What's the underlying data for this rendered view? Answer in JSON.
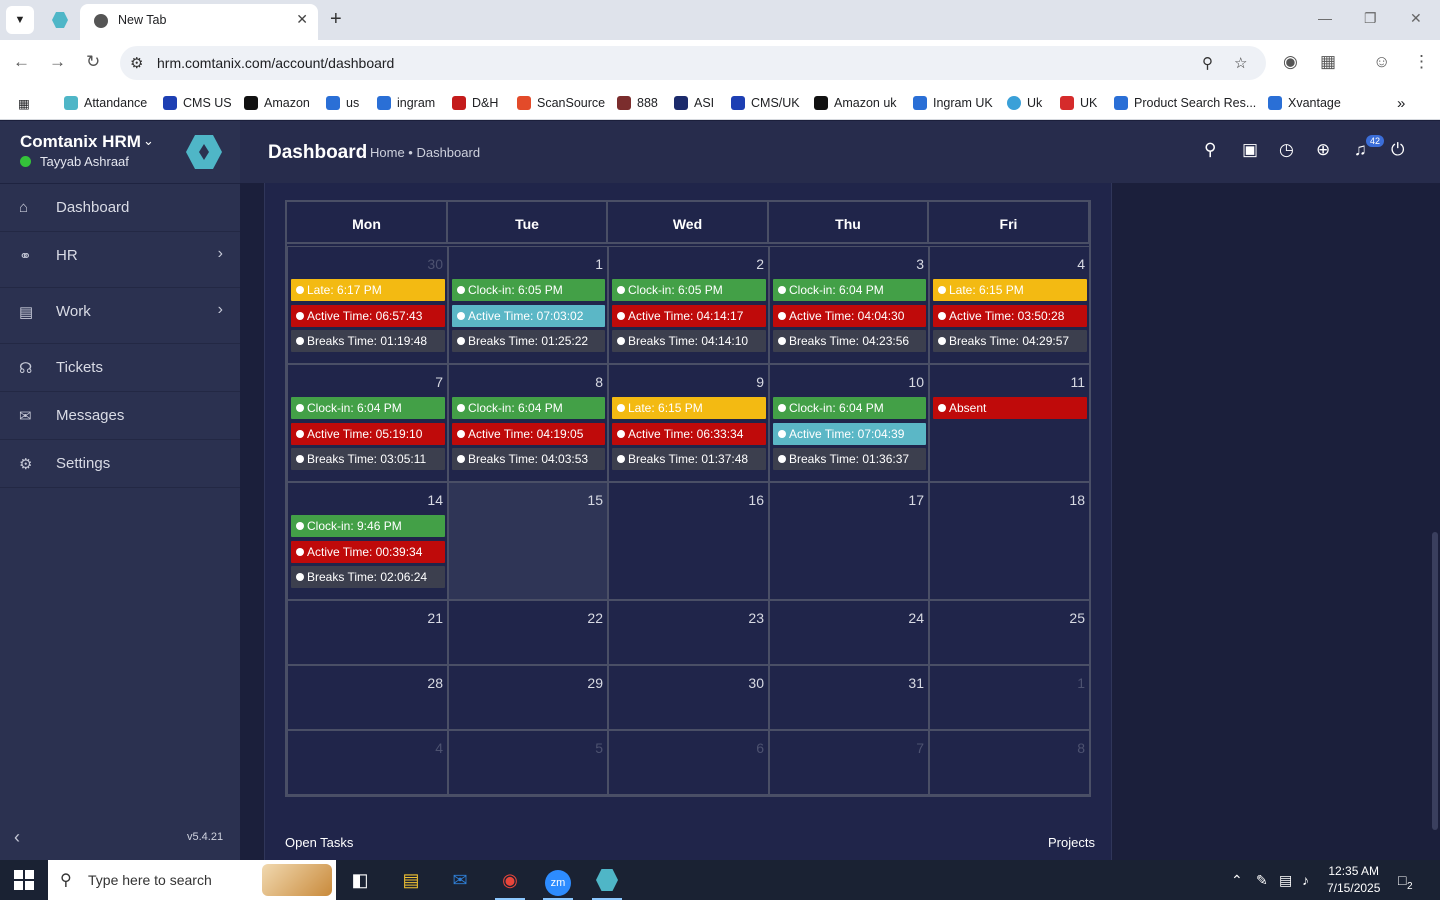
{
  "browser": {
    "tab_title": "New Tab",
    "url": "hrm.comtanix.com/account/dashboard",
    "bookmarks": [
      "Attandance",
      "CMS US",
      "Amazon",
      "us",
      "ingram",
      "D&H",
      "ScanSource",
      "888",
      "ASI",
      "CMS/UK",
      "Amazon uk",
      "Ingram UK",
      "Uk",
      "UK",
      "Product Search Res...",
      "Xvantage"
    ]
  },
  "sidebar": {
    "brand": "Comtanix HRM",
    "user": "Tayyab Ashraaf",
    "items": [
      {
        "label": "Dashboard",
        "icon": "home-icon"
      },
      {
        "label": "HR",
        "icon": "users-icon"
      },
      {
        "label": "Work",
        "icon": "briefcase-icon"
      },
      {
        "label": "Tickets",
        "icon": "headset-icon"
      },
      {
        "label": "Messages",
        "icon": "message-icon"
      },
      {
        "label": "Settings",
        "icon": "gear-icon"
      }
    ],
    "version": "v5.4.21"
  },
  "header": {
    "title": "Dashboard",
    "breadcrumb": "Home • Dashboard",
    "notification_count": "42"
  },
  "calendar": {
    "weekdays": [
      "Mon",
      "Tue",
      "Wed",
      "Thu",
      "Fri"
    ],
    "weeks": [
      [
        {
          "day": "30",
          "muted": true,
          "events": [
            {
              "type": "yellow",
              "text": "Late: 6:17 PM"
            },
            {
              "type": "red",
              "text": "Active Time: 06:57:43"
            },
            {
              "type": "gray",
              "text": "Breaks Time: 01:19:48"
            }
          ]
        },
        {
          "day": "1",
          "events": [
            {
              "type": "green",
              "text": "Clock-in: 6:05 PM"
            },
            {
              "type": "teal",
              "text": "Active Time: 07:03:02"
            },
            {
              "type": "gray",
              "text": "Breaks Time: 01:25:22"
            }
          ]
        },
        {
          "day": "2",
          "events": [
            {
              "type": "green",
              "text": "Clock-in: 6:05 PM"
            },
            {
              "type": "red",
              "text": "Active Time: 04:14:17"
            },
            {
              "type": "gray",
              "text": "Breaks Time: 04:14:10"
            }
          ]
        },
        {
          "day": "3",
          "events": [
            {
              "type": "green",
              "text": "Clock-in: 6:04 PM"
            },
            {
              "type": "red",
              "text": "Active Time: 04:04:30"
            },
            {
              "type": "gray",
              "text": "Breaks Time: 04:23:56"
            }
          ]
        },
        {
          "day": "4",
          "events": [
            {
              "type": "yellow",
              "text": "Late: 6:15 PM"
            },
            {
              "type": "red",
              "text": "Active Time: 03:50:28"
            },
            {
              "type": "gray",
              "text": "Breaks Time: 04:29:57"
            }
          ]
        }
      ],
      [
        {
          "day": "7",
          "events": [
            {
              "type": "green",
              "text": "Clock-in: 6:04 PM"
            },
            {
              "type": "red",
              "text": "Active Time: 05:19:10"
            },
            {
              "type": "gray",
              "text": "Breaks Time: 03:05:11"
            }
          ]
        },
        {
          "day": "8",
          "events": [
            {
              "type": "green",
              "text": "Clock-in: 6:04 PM"
            },
            {
              "type": "red",
              "text": "Active Time: 04:19:05"
            },
            {
              "type": "gray",
              "text": "Breaks Time: 04:03:53"
            }
          ]
        },
        {
          "day": "9",
          "events": [
            {
              "type": "yellow",
              "text": "Late: 6:15 PM"
            },
            {
              "type": "red",
              "text": "Active Time: 06:33:34"
            },
            {
              "type": "gray",
              "text": "Breaks Time: 01:37:48"
            }
          ]
        },
        {
          "day": "10",
          "events": [
            {
              "type": "green",
              "text": "Clock-in: 6:04 PM"
            },
            {
              "type": "teal",
              "text": "Active Time: 07:04:39"
            },
            {
              "type": "gray",
              "text": "Breaks Time: 01:36:37"
            }
          ]
        },
        {
          "day": "11",
          "events": [
            {
              "type": "red",
              "text": "Absent"
            }
          ]
        }
      ],
      [
        {
          "day": "14",
          "events": [
            {
              "type": "green",
              "text": "Clock-in: 9:46 PM"
            },
            {
              "type": "red",
              "text": "Active Time: 00:39:34"
            },
            {
              "type": "gray",
              "text": "Breaks Time: 02:06:24"
            }
          ]
        },
        {
          "day": "15",
          "today": true,
          "events": []
        },
        {
          "day": "16",
          "events": []
        },
        {
          "day": "17",
          "events": []
        },
        {
          "day": "18",
          "events": []
        }
      ],
      [
        {
          "day": "21",
          "events": []
        },
        {
          "day": "22",
          "events": []
        },
        {
          "day": "23",
          "events": []
        },
        {
          "day": "24",
          "events": []
        },
        {
          "day": "25",
          "events": []
        }
      ],
      [
        {
          "day": "28",
          "events": []
        },
        {
          "day": "29",
          "events": []
        },
        {
          "day": "30",
          "events": []
        },
        {
          "day": "31",
          "events": []
        },
        {
          "day": "1",
          "muted": true,
          "events": []
        }
      ],
      [
        {
          "day": "4",
          "muted": true,
          "events": []
        },
        {
          "day": "5",
          "muted": true,
          "events": []
        },
        {
          "day": "6",
          "muted": true,
          "events": []
        },
        {
          "day": "7",
          "muted": true,
          "events": []
        },
        {
          "day": "8",
          "muted": true,
          "events": []
        }
      ]
    ]
  },
  "footer": {
    "left": "Open Tasks",
    "right": "Projects"
  },
  "taskbar": {
    "search_placeholder": "Type here to search",
    "time": "12:35 AM",
    "date": "7/15/2025",
    "notification_count": "2"
  }
}
